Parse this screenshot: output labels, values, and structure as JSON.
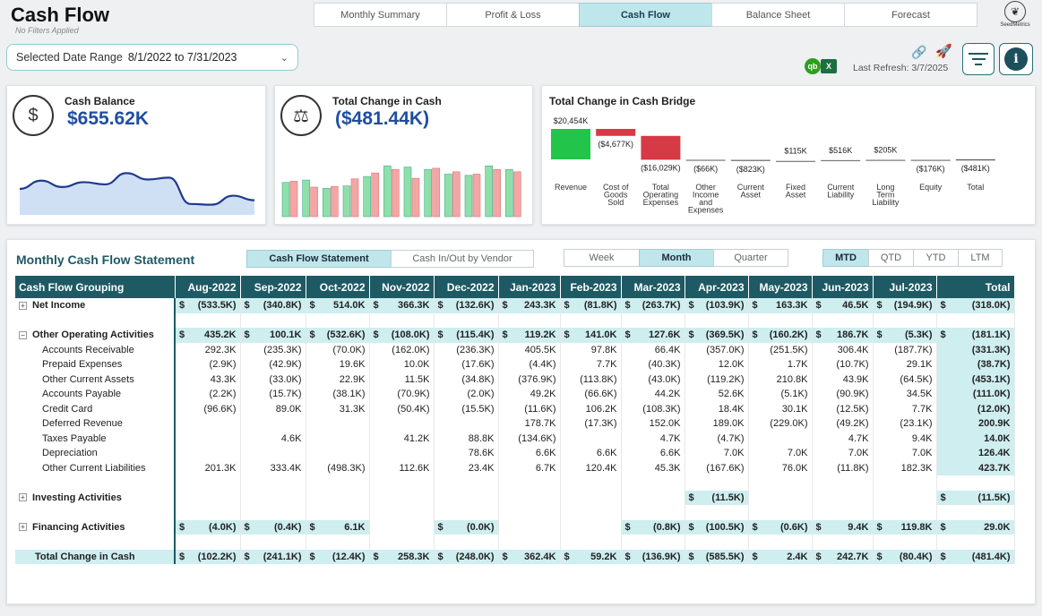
{
  "header": {
    "title": "Cash Flow",
    "subtitle": "No Filters Applied",
    "tabs": [
      {
        "label": "Monthly Summary",
        "active": false
      },
      {
        "label": "Profit & Loss",
        "active": false
      },
      {
        "label": "Cash Flow",
        "active": true
      },
      {
        "label": "Balance Sheet",
        "active": false
      },
      {
        "label": "Forecast",
        "active": false
      }
    ],
    "logo_text": "SeedMetrics",
    "last_refresh": "Last Refresh: 3/7/2025"
  },
  "date_filter": {
    "label": "Selected Date Range",
    "value": "8/1/2022 to 7/31/2023"
  },
  "kpis": {
    "cash_balance": {
      "title": "Cash Balance",
      "value": "$655.62K"
    },
    "total_change": {
      "title": "Total Change in Cash",
      "value": "($481.44K)"
    }
  },
  "bridge": {
    "title": "Total Change in Cash Bridge"
  },
  "statement": {
    "title": "Monthly Cash Flow Statement",
    "view_buttons": [
      {
        "label": "Cash Flow Statement",
        "active": true
      },
      {
        "label": "Cash In/Out by Vendor",
        "active": false
      }
    ],
    "period_buttons": [
      {
        "label": "Week",
        "active": false
      },
      {
        "label": "Month",
        "active": true
      },
      {
        "label": "Quarter",
        "active": false
      }
    ],
    "range_buttons": [
      {
        "label": "MTD",
        "active": true
      },
      {
        "label": "QTD",
        "active": false
      },
      {
        "label": "YTD",
        "active": false
      },
      {
        "label": "LTM",
        "active": false
      }
    ],
    "columns": [
      "Cash Flow Grouping",
      "Aug-2022",
      "Sep-2022",
      "Oct-2022",
      "Nov-2022",
      "Dec-2022",
      "Jan-2023",
      "Feb-2023",
      "Mar-2023",
      "Apr-2023",
      "May-2023",
      "Jun-2023",
      "Jul-2023",
      "Total"
    ],
    "rows": [
      {
        "name": "Net Income",
        "type": "group",
        "dollar": true,
        "values": [
          "(533.5K)",
          "(340.8K)",
          "514.0K",
          "366.3K",
          "(132.6K)",
          "243.3K",
          "(81.8K)",
          "(263.7K)",
          "(103.9K)",
          "163.3K",
          "46.5K",
          "(194.9K)",
          "(318.0K)"
        ]
      },
      {
        "type": "blank"
      },
      {
        "name": "Other Operating Activities",
        "type": "group",
        "dollar": true,
        "expanded": true,
        "values": [
          "435.2K",
          "100.1K",
          "(532.6K)",
          "(108.0K)",
          "(115.4K)",
          "119.2K",
          "141.0K",
          "127.6K",
          "(369.5K)",
          "(160.2K)",
          "186.7K",
          "(5.3K)",
          "(181.1K)"
        ]
      },
      {
        "name": "Accounts Receivable",
        "type": "sub",
        "values": [
          "292.3K",
          "(235.3K)",
          "(70.0K)",
          "(162.0K)",
          "(236.3K)",
          "405.5K",
          "97.8K",
          "66.4K",
          "(357.0K)",
          "(251.5K)",
          "306.4K",
          "(187.7K)",
          "(331.3K)"
        ]
      },
      {
        "name": "Prepaid Expenses",
        "type": "sub",
        "values": [
          "(2.9K)",
          "(42.9K)",
          "19.6K",
          "10.0K",
          "(17.6K)",
          "(4.4K)",
          "7.7K",
          "(40.3K)",
          "12.0K",
          "1.7K",
          "(10.7K)",
          "29.1K",
          "(38.7K)"
        ]
      },
      {
        "name": "Other Current Assets",
        "type": "sub",
        "values": [
          "43.3K",
          "(33.0K)",
          "22.9K",
          "11.5K",
          "(34.8K)",
          "(376.9K)",
          "(113.8K)",
          "(43.0K)",
          "(119.2K)",
          "210.8K",
          "43.9K",
          "(64.5K)",
          "(453.1K)"
        ]
      },
      {
        "name": "Accounts Payable",
        "type": "sub",
        "values": [
          "(2.2K)",
          "(15.7K)",
          "(38.1K)",
          "(70.9K)",
          "(2.0K)",
          "49.2K",
          "(66.6K)",
          "44.2K",
          "52.6K",
          "(5.1K)",
          "(90.9K)",
          "34.5K",
          "(111.0K)"
        ]
      },
      {
        "name": "Credit Card",
        "type": "sub",
        "values": [
          "(96.6K)",
          "89.0K",
          "31.3K",
          "(50.4K)",
          "(15.5K)",
          "(11.6K)",
          "106.2K",
          "(108.3K)",
          "18.4K",
          "30.1K",
          "(12.5K)",
          "7.7K",
          "(12.0K)"
        ]
      },
      {
        "name": "Deferred Revenue",
        "type": "sub",
        "values": [
          "",
          "",
          "",
          "",
          "",
          "178.7K",
          "(17.3K)",
          "152.0K",
          "189.0K",
          "(229.0K)",
          "(49.2K)",
          "(23.1K)",
          "200.9K"
        ]
      },
      {
        "name": "Taxes Payable",
        "type": "sub",
        "values": [
          "",
          "4.6K",
          "",
          "41.2K",
          "88.8K",
          "(134.6K)",
          "",
          "4.7K",
          "(4.7K)",
          "",
          "4.7K",
          "9.4K",
          "14.0K"
        ]
      },
      {
        "name": "Depreciation",
        "type": "sub",
        "values": [
          "",
          "",
          "",
          "",
          "78.6K",
          "6.6K",
          "6.6K",
          "6.6K",
          "7.0K",
          "7.0K",
          "7.0K",
          "7.0K",
          "126.4K"
        ]
      },
      {
        "name": "Other Current Liabilities",
        "type": "sub",
        "values": [
          "201.3K",
          "333.4K",
          "(498.3K)",
          "112.6K",
          "23.4K",
          "6.7K",
          "120.4K",
          "45.3K",
          "(167.6K)",
          "76.0K",
          "(11.8K)",
          "182.3K",
          "423.7K"
        ]
      },
      {
        "type": "blank"
      },
      {
        "name": "Investing Activities",
        "type": "group",
        "dollar": true,
        "values": [
          "",
          "",
          "",
          "",
          "",
          "",
          "",
          "",
          "(11.5K)",
          "",
          "",
          "",
          "(11.5K)"
        ]
      },
      {
        "type": "blank"
      },
      {
        "name": "Financing Activities",
        "type": "group",
        "dollar": true,
        "values": [
          "(4.0K)",
          "(0.4K)",
          "6.1K",
          "",
          "(0.0K)",
          "",
          "",
          "(0.8K)",
          "(100.5K)",
          "(0.6K)",
          "9.4K",
          "119.8K",
          "29.0K"
        ]
      },
      {
        "type": "blank"
      },
      {
        "name": "Total Change in Cash",
        "type": "total",
        "dollar": true,
        "values": [
          "(102.2K)",
          "(241.1K)",
          "(12.4K)",
          "258.3K",
          "(248.0K)",
          "362.4K",
          "59.2K",
          "(136.9K)",
          "(585.5K)",
          "2.4K",
          "242.7K",
          "(80.4K)",
          "(481.4K)"
        ]
      }
    ]
  },
  "chart_data": [
    {
      "type": "area",
      "title": "Cash Balance",
      "values": [
        0.5,
        0.72,
        0.55,
        0.68,
        0.62,
        0.92,
        0.75,
        0.8,
        0.1,
        0.08,
        0.32,
        0.2
      ]
    },
    {
      "type": "bar",
      "title": "Total Change in Cash",
      "series": [
        {
          "color": "#8fe0a8",
          "values": [
            0.58,
            0.62,
            0.48,
            0.52,
            0.68,
            0.86,
            0.84,
            0.8,
            0.72,
            0.7,
            0.86,
            0.8
          ]
        },
        {
          "color": "#f4a6a6",
          "values": [
            0.6,
            0.5,
            0.51,
            0.64,
            0.74,
            0.8,
            0.65,
            0.82,
            0.76,
            0.72,
            0.8,
            0.76
          ]
        }
      ]
    },
    {
      "type": "bar",
      "subtype": "waterfall",
      "title": "Total Change in Cash Bridge",
      "categories": [
        "Revenue",
        "Cost of Goods Sold",
        "Total Operating Expenses",
        "Other Income and Expenses",
        "Current Asset",
        "Fixed Asset",
        "Current Liability",
        "Long Term Liability",
        "Equity",
        "Total"
      ],
      "values": [
        20454,
        -4677,
        -16029,
        -66,
        -823,
        115,
        516,
        205,
        -176,
        -481
      ],
      "labels": [
        "$20,454K",
        "($4,677K)",
        "($16,029K)",
        "($66K)",
        "($823K)",
        "$115K",
        "$516K",
        "$205K",
        "($176K)",
        "($481K)"
      ],
      "colors": {
        "positive": "#22c44a",
        "negative": "#d63a45",
        "total": "#555555"
      }
    }
  ]
}
